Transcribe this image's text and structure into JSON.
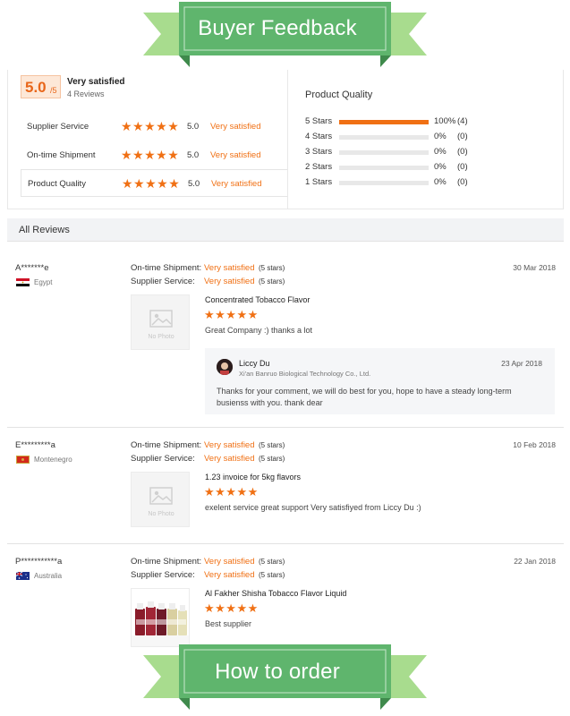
{
  "banner_top": {
    "title": "Buyer Feedback"
  },
  "banner_bottom": {
    "title": "How to order"
  },
  "summary": {
    "score": "5.0",
    "score_max": "/5",
    "overall_label": "Very satisfied",
    "review_count": "4 Reviews",
    "ratings": [
      {
        "label": "Supplier Service",
        "score": "5.0",
        "text": "Very satisfied",
        "stars": 5
      },
      {
        "label": "On-time Shipment",
        "score": "5.0",
        "text": "Very satisfied",
        "stars": 5
      },
      {
        "label": "Product Quality",
        "score": "5.0",
        "text": "Very satisfied",
        "stars": 5
      }
    ]
  },
  "product_quality": {
    "title": "Product Quality",
    "rows": [
      {
        "label": "5 Stars",
        "pct": "100%",
        "count": "(4)",
        "fill": 1.0
      },
      {
        "label": "4 Stars",
        "pct": "0%",
        "count": "(0)",
        "fill": 0
      },
      {
        "label": "3 Stars",
        "pct": "0%",
        "count": "(0)",
        "fill": 0
      },
      {
        "label": "2 Stars",
        "pct": "0%",
        "count": "(0)",
        "fill": 0
      },
      {
        "label": "1 Stars",
        "pct": "0%",
        "count": "(0)",
        "fill": 0
      }
    ]
  },
  "all_reviews": {
    "title": "All Reviews"
  },
  "labels": {
    "shipment": "On-time Shipment:",
    "service": "Supplier Service:",
    "satisfied": "Very satisfied",
    "five_stars": "(5 stars)",
    "no_photo": "No Photo",
    "star_glyphs": "★★★★★"
  },
  "reviews": [
    {
      "name": "A*******e",
      "country": "Egypt",
      "date": "30 Mar 2018",
      "product": "Concentrated Tobacco Flavor",
      "comment": "Great Company :) thanks a lot",
      "reply": {
        "name": "Liccy Du",
        "company": "Xi'an Banruo Biological Technology Co., Ltd.",
        "date": "23 Apr 2018",
        "text": "Thanks for your comment, we will do best for you, hope to have a steady long-term busienss with you. thank dear"
      }
    },
    {
      "name": "E*********a",
      "country": "Montenegro",
      "date": "10 Feb 2018",
      "product": "1.23 invoice for 5kg flavors",
      "comment": "exelent service great support Very satisfiyed from Liccy Du :)"
    },
    {
      "name": "P***********a",
      "country": "Australia",
      "date": "22 Jan 2018",
      "product": "Al Fakher Shisha Tobacco Flavor Liquid",
      "comment": "Best supplier"
    }
  ],
  "colors": {
    "accent": "#f07014",
    "ribbon_green": "#5fb56d",
    "ribbon_dark": "#3f8a4c",
    "ribbon_light": "#a8dc8e"
  }
}
